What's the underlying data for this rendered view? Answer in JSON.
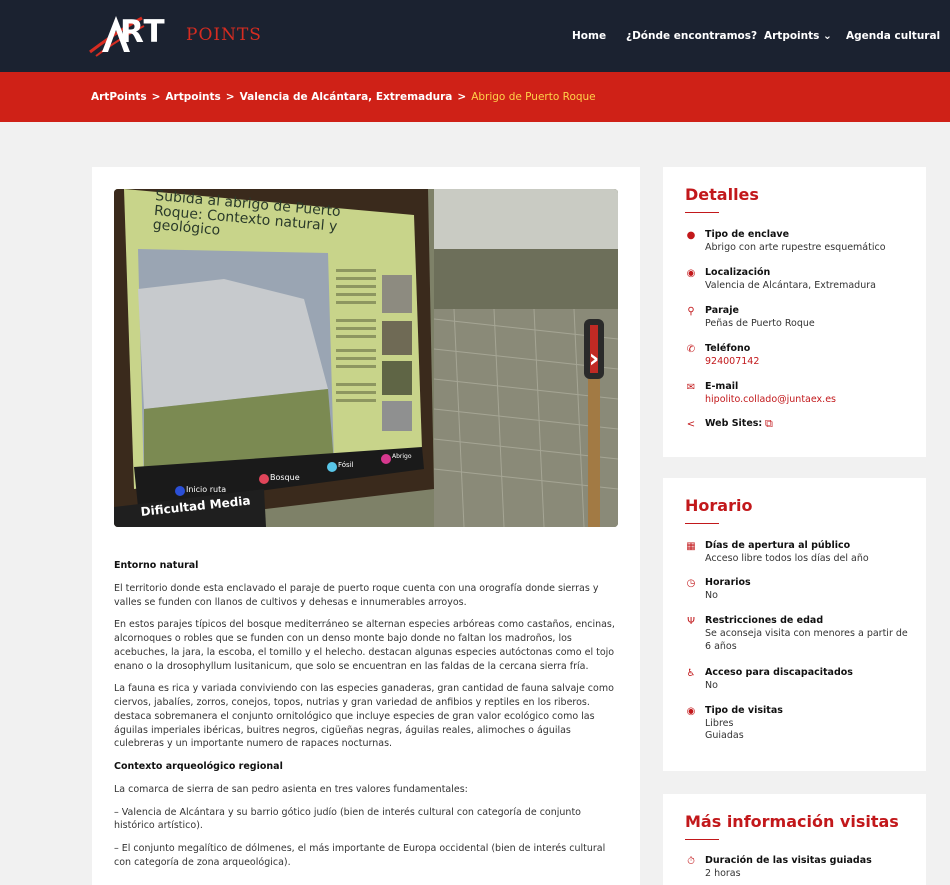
{
  "header": {
    "logo_brand": "RT",
    "logo_points": "POINTS",
    "nav": [
      "Home",
      "¿Dónde encontramos?",
      "Artpoints ⌄",
      "Agenda cultural"
    ]
  },
  "breadcrumb": {
    "items": [
      "ArtPoints",
      "Artpoints",
      "Valencia de Alcántara, Extremadura"
    ],
    "current": "Abrigo de Puerto Roque",
    "separator": ">"
  },
  "slider": {
    "sign_title": "Subida al abrigo de Puerto Roque: Contexto natural y geológico",
    "legend": [
      "Inicio ruta",
      "Bosque",
      "Fósil",
      "Abrigo"
    ],
    "difficulty": "Dificultad Media"
  },
  "article": {
    "heading1": "Entorno natural",
    "p1": "El territorio  donde esta enclavado el paraje de puerto roque cuenta con una orografía donde sierras y valles se funden con llanos de cultivos y dehesas e innumerables arroyos.",
    "p2": "En estos parajes típicos del bosque mediterráneo se alternan especies arbóreas como castaños, encinas, alcornoques o robles que se funden con un denso monte bajo donde no faltan los madroños, los acebuches, la jara, la escoba, el tomillo y el helecho. destacan algunas especies autóctonas como el tojo enano o la drosophyllum lusitanicum, que solo se encuentran en las faldas de la cercana sierra fría.",
    "p3": "La fauna es rica y variada conviviendo con las especies ganaderas, gran cantidad de fauna salvaje como ciervos, jabalíes, zorros, conejos, topos, nutrias y gran variedad de anfibios y reptiles en los riberos. destaca sobremanera el conjunto ornitológico que incluye especies de gran valor ecológico como las águilas imperiales ibéricas, buitres negros, cigüeñas negras, águilas reales, alimoches o águilas culebreras y un importante numero de rapaces nocturnas.",
    "heading2": "Contexto arqueológico regional",
    "p4": "La comarca de sierra de san pedro asienta en tres valores fundamentales:",
    "p5": "– Valencia de Alcántara y su barrio gótico judío (bien de  interés cultural con categoría de conjunto histórico artístico).",
    "p6": "– El conjunto megalítico de dólmenes, el más importante de Europa occidental (bien de interés cultural con categoría de zona arqueológica)."
  },
  "detalles": {
    "title": "Detalles",
    "items": [
      {
        "icon": "map-marker-icon",
        "label": "Tipo de enclave",
        "value": "Abrigo con arte rupestre esquemático"
      },
      {
        "icon": "location-pin-icon",
        "label": "Localización",
        "value": "Valencia de Alcántara, Extremadura"
      },
      {
        "icon": "pushpin-icon",
        "label": "Paraje",
        "value": "Peñas de Puerto Roque"
      },
      {
        "icon": "phone-icon",
        "label": "Teléfono",
        "value": "924007142"
      },
      {
        "icon": "envelope-icon",
        "label": "E-mail",
        "value": "hipolito.collado@juntaex.es"
      },
      {
        "icon": "share-icon",
        "label": "Web Sites:",
        "value": ""
      }
    ]
  },
  "horario": {
    "title": "Horario",
    "items": [
      {
        "icon": "calendar-icon",
        "label": "Días de apertura al público",
        "value": "Acceso libre todos los días del año"
      },
      {
        "icon": "clock-icon",
        "label": "Horarios",
        "value": "No"
      },
      {
        "icon": "person-icon",
        "label": "Restricciones de edad",
        "value": "Se aconseja visita con menores a partir de 6 años"
      },
      {
        "icon": "wheelchair-icon",
        "label": "Acceso para discapacitados",
        "value": "No"
      },
      {
        "icon": "eye-icon",
        "label": "Tipo de visitas",
        "value": "Libres",
        "value2": "Guiadas"
      }
    ]
  },
  "info": {
    "title": "Más información visitas",
    "items": [
      {
        "icon": "stopwatch-icon",
        "label": "Duración de las visitas guiadas",
        "value": "2 horas"
      }
    ]
  },
  "colors": {
    "header_bg": "#1b2230",
    "accent_red": "#cf2117",
    "breadcrumb_current": "#ffd24a",
    "title_red": "#c2181b"
  }
}
